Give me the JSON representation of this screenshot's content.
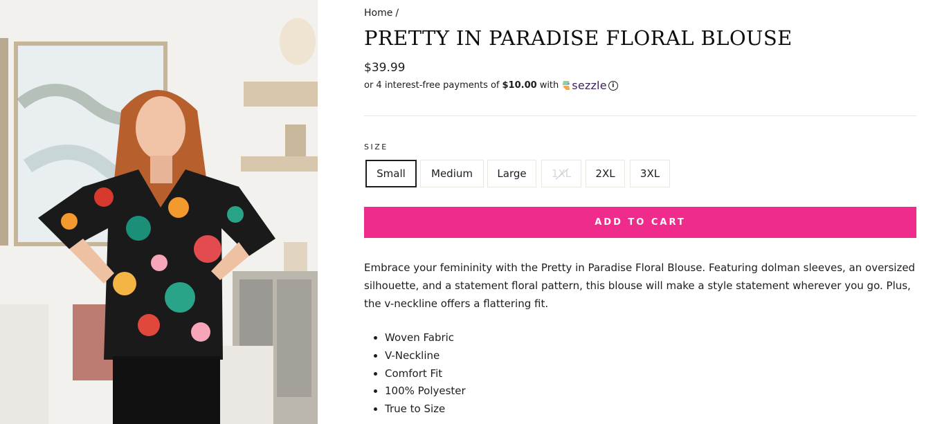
{
  "breadcrumb": {
    "home": "Home",
    "separator": "/"
  },
  "product": {
    "title": "PRETTY IN PARADISE FLORAL BLOUSE",
    "price": "$39.99",
    "sezzle": {
      "prefix": "or 4 interest-free payments of",
      "amount": "$10.00",
      "with": "with",
      "brand": "sezzle",
      "info_icon": "i"
    },
    "size_label": "SIZE",
    "sizes": [
      {
        "label": "Small",
        "selected": true,
        "available": true
      },
      {
        "label": "Medium",
        "selected": false,
        "available": true
      },
      {
        "label": "Large",
        "selected": false,
        "available": true
      },
      {
        "label": "1XL",
        "selected": false,
        "available": false
      },
      {
        "label": "2XL",
        "selected": false,
        "available": true
      },
      {
        "label": "3XL",
        "selected": false,
        "available": true
      }
    ],
    "add_to_cart": "ADD TO CART",
    "description": "Embrace your femininity with the Pretty in Paradise Floral Blouse. Featuring dolman sleeves, an oversized silhouette, and a statement floral pattern, this blouse will make a style statement wherever you go. Plus, the v-neckline offers a flattering fit.",
    "features": [
      "Woven Fabric",
      "V-Neckline",
      "Comfort Fit",
      "100% Polyester",
      "True to Size"
    ]
  },
  "colors": {
    "accent": "#ef2b8c",
    "text": "#1c1d1d",
    "sezzle_brand": "#392558",
    "border": "#e8e8e1"
  },
  "icons": [
    "sezzle-logo-icon",
    "info-icon"
  ]
}
